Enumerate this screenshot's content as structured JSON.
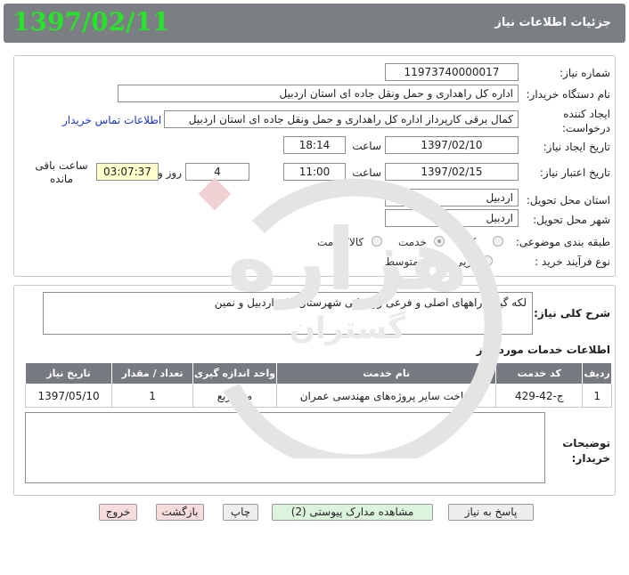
{
  "header": {
    "title": "جزئیات اطلاعات نیاز",
    "date_overlay": "1397/02/11"
  },
  "form": {
    "need_number": {
      "label": "شماره نیاز:",
      "value": "11973740000017"
    },
    "buyer_org": {
      "label": "نام دستگاه خریدار:",
      "value": "اداره کل راهداری و حمل ونقل جاده ای استان اردبیل"
    },
    "requester": {
      "label": "ایجاد کننده درخواست:",
      "value": "کمال برقی کارپرداز اداره کل راهداری و حمل ونقل جاده ای استان اردبیل",
      "contact_link": "اطلاعات تماس خریدار"
    },
    "created": {
      "label": "تاریخ ایجاد نیاز:",
      "date": "1397/02/10",
      "time_label": "ساعت",
      "time": "18:14"
    },
    "validity": {
      "label": "تاریخ اعتبار نیاز:",
      "date": "1397/02/15",
      "time_label": "ساعت",
      "time": "11:00",
      "days": "4",
      "days_label": "روز و",
      "remaining": "03:07:37",
      "remaining_label": "ساعت باقی مانده"
    },
    "delivery_province": {
      "label": "استان محل تحویل:",
      "value": "اردبیل"
    },
    "delivery_city": {
      "label": "شهر محل تحویل:",
      "value": "اردبیل"
    },
    "category": {
      "label": "طبقه بندی موضوعی:",
      "options": [
        "کالا",
        "خدمت",
        "کالا/خدمت"
      ],
      "selected": "خدمت"
    },
    "process": {
      "label": "نوع فرآیند خرید :",
      "options": [
        "جزیی",
        "متوسط"
      ],
      "selected": "متوسط"
    }
  },
  "description": {
    "label": "شرح کلی نیاز:",
    "value": "لکه گیری راههای اصلی و فرعی روستایی شهرستان های اردبیل و نمین"
  },
  "services": {
    "title": "اطلاعات خدمات مورد نیاز",
    "columns": [
      "ردیف",
      "کد خدمت",
      "نام خدمت",
      "واحد اندازه گیری",
      "تعداد / مقدار",
      "تاریخ نیاز"
    ],
    "rows": [
      [
        "1",
        "ج-42-429",
        "ساخت سایر پروژه‌های مهندسی عمران",
        "مترمربع",
        "1",
        "1397/05/10"
      ]
    ]
  },
  "buyer_notes": {
    "label": "توضیحات خریدار:",
    "value": ""
  },
  "watermark": {
    "main": "هزاره",
    "sub": "گستران"
  },
  "buttons": {
    "respond": "پاسخ به نیاز",
    "attachments": "مشاهده مدارک پیوستی (2)",
    "print": "چاپ",
    "back": "بازگشت",
    "exit": "خروج"
  },
  "colors": {
    "header_bg": "#7b7e83",
    "date_overlay": "#27e32a",
    "table_header": "#777a80",
    "remaining_bg": "#ffffcc",
    "link": "#1a33cc"
  }
}
